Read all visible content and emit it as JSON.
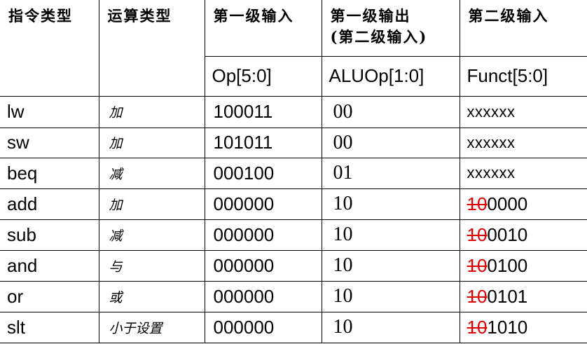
{
  "headers": {
    "instruction_type": "指令类型",
    "operation_type": "运算类型",
    "stage1_input": "第一级输入",
    "stage1_output_line1": "第一级输出",
    "stage1_output_line2": "(第二级输入)",
    "stage2_input": "第二级输入",
    "op_field": "Op[5:0]",
    "aluop_field": "ALUOp[1:0]",
    "funct_field": "Funct[5:0]"
  },
  "rows": [
    {
      "instr": "lw",
      "op": "加",
      "opcode": "100011",
      "aluop": "00",
      "funct_struck": "",
      "funct": "xxxxxx"
    },
    {
      "instr": "sw",
      "op": "加",
      "opcode": "101011",
      "aluop": "00",
      "funct_struck": "",
      "funct": "xxxxxx"
    },
    {
      "instr": "beq",
      "op": "减",
      "opcode": "000100",
      "aluop": "01",
      "funct_struck": "",
      "funct": "xxxxxx"
    },
    {
      "instr": "add",
      "op": "加",
      "opcode": "000000",
      "aluop": "10",
      "funct_struck": "10",
      "funct": "0000"
    },
    {
      "instr": "sub",
      "op": "减",
      "opcode": "000000",
      "aluop": "10",
      "funct_struck": "10",
      "funct": "0010"
    },
    {
      "instr": "and",
      "op": "与",
      "opcode": "000000",
      "aluop": "10",
      "funct_struck": "10",
      "funct": "0100"
    },
    {
      "instr": "or",
      "op": "或",
      "opcode": "000000",
      "aluop": "10",
      "funct_struck": "10",
      "funct": "0101"
    },
    {
      "instr": "slt",
      "op": "小于设置",
      "opcode": "000000",
      "aluop": "10",
      "funct_struck": "10",
      "funct": "1010"
    }
  ],
  "colors": {
    "border": "#000000",
    "strike": "#e00000"
  }
}
